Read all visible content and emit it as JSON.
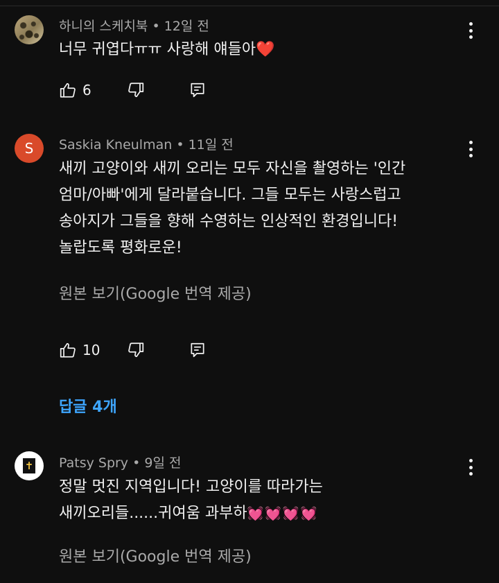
{
  "comments": [
    {
      "author": "하니의 스케치북",
      "time": "12일 전",
      "text": "너무 귀엽다ㅠㅠ 사랑해 얘들아",
      "emoji": "❤️",
      "likes": "6"
    },
    {
      "author": "Saskia Kneulman",
      "avatar_letter": "S",
      "time": "11일 전",
      "lines": [
        "새끼 고양이와 새끼 오리는 모두 자신을 촬영하는 '인간",
        "엄마/아빠'에게 달라붙습니다. 그들 모두는 사랑스럽고",
        "송아지가 그들을 향해 수영하는 인상적인 환경입니다!",
        "놀랍도록 평화로운!"
      ],
      "translate": "원본 보기(Google 번역 제공)",
      "likes": "10",
      "replies": "답글 4개"
    },
    {
      "author": "Patsy Spry",
      "avatar_symbol": "✝",
      "time": "9일 전",
      "lines": [
        "정말 멋진 지역입니다! 고양이를 따라가는",
        "새끼오리들......귀여움 과부하"
      ],
      "emoji": "💓💓💓💓",
      "translate": "원본 보기(Google 번역 제공)"
    }
  ],
  "icons": {
    "like": "thumbs-up-icon",
    "dislike": "thumbs-down-icon",
    "reply": "reply-icon",
    "more": "more-vert-icon"
  },
  "colors": {
    "background": "#0f0f0f",
    "link": "#3ea6ff",
    "secondary_text": "#aaaaaa",
    "avatar_s": "#d94a2a"
  }
}
